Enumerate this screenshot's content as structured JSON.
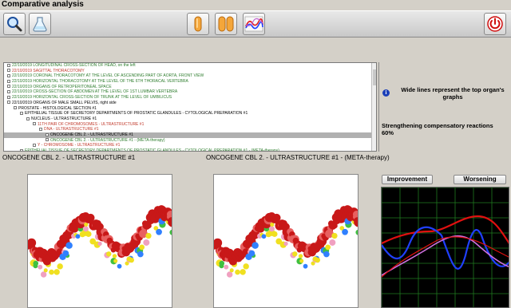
{
  "window": {
    "title": "Comparative analysis"
  },
  "toolbar": {
    "buttons": [
      {
        "name": "search-button",
        "icon": "magnifier-icon"
      },
      {
        "name": "flask-button",
        "icon": "flask-icon"
      },
      {
        "name": "single-capsule-button",
        "icon": "capsule-icon"
      },
      {
        "name": "double-capsule-button",
        "icon": "double-capsule-icon"
      },
      {
        "name": "chart-button",
        "icon": "line-chart-icon"
      },
      {
        "name": "power-button",
        "icon": "power-icon"
      }
    ]
  },
  "tree": {
    "rows": [
      {
        "indent": 0,
        "text": "22/10/2019  LONGITUDINAL CROSS-SECTION OF HEAD, on the left",
        "color": "#2e7d2e"
      },
      {
        "indent": 0,
        "text": "22/10/2019  SAGITTAL THORACOTOMY",
        "color": "#c0392b"
      },
      {
        "indent": 0,
        "text": "22/10/2019  CORONAL THORACOTOMY AT THE LEVEL OF ASCENDING PART OF AORTA, FRONT VIEW",
        "color": "#2e7d2e"
      },
      {
        "indent": 0,
        "text": "22/10/2019  HORIZONTAL THORACOTOMY AT THE LEVEL OF THE 6TH THORACAL VERTEBRA",
        "color": "#2e7d2e"
      },
      {
        "indent": 0,
        "text": "22/10/2019  ORGANS OF RETROPERITONEAL SPACE",
        "color": "#2e7d2e"
      },
      {
        "indent": 0,
        "text": "22/10/2019  CROSS-SECTION OF ABDOMEN AT THE LEVEL OF 1ST LUMBAR VERTEBRA",
        "color": "#2e7d2e"
      },
      {
        "indent": 0,
        "text": "22/10/2019  HORIZONTAL CROSS-SECTION OF TRUNK AT THE LEVEL OF UMBILICUS",
        "color": "#2e7d2e"
      },
      {
        "indent": 0,
        "text": "22/10/2019  ORGANS OF MALE SMALL PELVIS, right side",
        "color": "#000000"
      },
      {
        "indent": 1,
        "text": "PROSTATE - HISTOLOGICAL SECTION #1",
        "color": "#000000"
      },
      {
        "indent": 2,
        "text": "EPITHELIAL TISSUE OF SECRETORY DEPARTMENTS OF PROSTATIC GLANDULES - CYTOLOGICAL PREPARATION #1",
        "color": "#000000"
      },
      {
        "indent": 3,
        "text": "NUCLEUS - ULTRASTRUCTURE #1",
        "color": "#000000"
      },
      {
        "indent": 4,
        "text": "11TH PAIR OF CHROMOSOMES - ULTRASTRUCTURE #1",
        "color": "#c0392b"
      },
      {
        "indent": 5,
        "text": "DNA - ULTRASTRUCTURE #1",
        "color": "#c0392b"
      },
      {
        "indent": 6,
        "text": "ONCOGENE CBL 2. - ULTRASTRUCTURE #1",
        "color": "#000000",
        "selected": true
      },
      {
        "indent": 6,
        "text": "ONCOGENE CBL 2. - ULTRASTRUCTURE #1 - (META-therapy)",
        "color": "#2e7d2e"
      },
      {
        "indent": 4,
        "text": "Y - CHROMOSOME - ULTRASTRUCTURE #1",
        "color": "#c0392b"
      },
      {
        "indent": 2,
        "text": "EPITHELIAL TISSUE OF SECRETORY DEPARTMENTS OF PROSTATIC GLANDULES - CYTOLOGICAL PREPARATION #1 - (META-therapy)",
        "color": "#2e7d2e"
      }
    ]
  },
  "info": {
    "message": "Wide lines represent the top organ's graphs",
    "icon": "info-icon",
    "strengthening_label": "Strengthening compensatory reactions",
    "strengthening_value": "60%"
  },
  "captions": {
    "left": "ONCOGENE CBL 2. - ULTRASTRUCTURE #1",
    "right": "ONCOGENE CBL 2. - ULTRASTRUCTURE #1 - (META-therapy)"
  },
  "graph_panel": {
    "improvement_label": "Improvement",
    "worsening_label": "Worsening",
    "colors": {
      "red": "#e01010",
      "blue": "#2040ff",
      "pink": "#d070e0",
      "grid": "#1f7a1f"
    }
  }
}
